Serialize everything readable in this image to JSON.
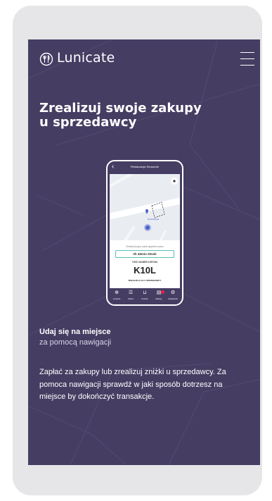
{
  "brand": {
    "name": "Lunicate",
    "logo_icon": "cutlery-circle-icon"
  },
  "menu": {
    "icon": "hamburger-icon"
  },
  "hero": {
    "title_line1": "Zrealizuj swoje zakupy",
    "title_line2": "u sprzedawcy"
  },
  "phone": {
    "header_title": "Restauracja Smacznie",
    "back_icon": "chevron-left-icon",
    "map": {
      "place_label": "Restauracja",
      "locate_icon": "target-icon",
      "pin_icon": "location-pin-icon"
    },
    "hint": "Zrealizuj kupon przed upływem czasu",
    "timer": "0h 45min 00sek",
    "code_label": "TWÓJ NUMER KUPONU",
    "code": "K10L",
    "redeem_label": "ZREALIZUJ CO U SPRZEDAWCY",
    "nav": [
      {
        "icon": "compass-icon",
        "label": "Lunicate"
      },
      {
        "icon": "list-icon",
        "label": "Oferta"
      },
      {
        "icon": "cart-icon",
        "label": "Koszyk"
      },
      {
        "icon": "orders-icon",
        "label": "Zakupy"
      },
      {
        "icon": "settings-icon",
        "label": "Ustawienia"
      }
    ]
  },
  "step": {
    "title": "Udaj się na miejsce",
    "subtitle": "za pomocą nawigacji"
  },
  "description": "Zapłać za zakupy lub zrealizuj zniżki u sprzedawcy. Za pomoca nawigacji sprawdź w jaki sposób dotrzesz na miejsce by dokończyć transakcje.",
  "colors": {
    "background": "#463d63",
    "accent": "#5bbfbb",
    "badge": "#e5214a",
    "frame": "#e6e6e9"
  }
}
